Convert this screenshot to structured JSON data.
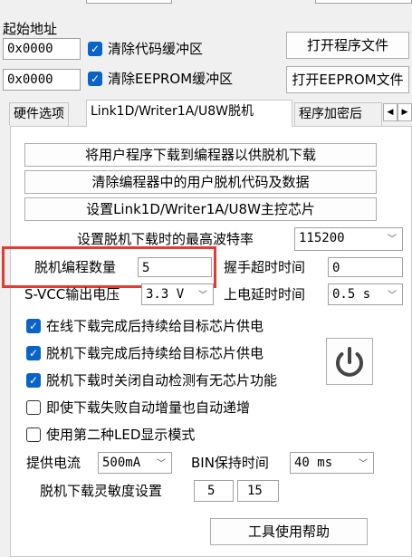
{
  "top": {
    "start_address_label": "起始地址",
    "code_addr_value": "0x0000",
    "clear_code_label": "清除代码缓冲区",
    "open_program_button": "打开程序文件",
    "eeprom_addr_value": "0x0000",
    "clear_eeprom_label": "清除EEPROM缓冲区",
    "open_eeprom_button": "打开EEPROM文件"
  },
  "tabs": [
    {
      "label": "硬件选项"
    },
    {
      "label": "Link1D/Writer1A/U8W脱机"
    },
    {
      "label": "程序加密后"
    }
  ],
  "tab_scroll": {
    "left": "◀",
    "right": "▶"
  },
  "panel": {
    "download_user_program_button": "将用户程序下载到编程器以供脱机下载",
    "clear_offline_code_button": "清除编程器中的用户脱机代码及数据",
    "set_main_chip_button": "设置Link1D/Writer1A/U8W主控芯片",
    "max_baud_label": "设置脱机下载时的最高波特率",
    "max_baud_value": "115200",
    "offline_count_label": "脱机编程数量",
    "offline_count_value": "5",
    "handshake_timeout_label": "握手超时时间",
    "handshake_timeout_value": "0",
    "svcc_label": "S-VCC输出电压",
    "svcc_value": "3.3 V",
    "power_delay_label": "上电延时时间",
    "power_delay_value": "0.5 s",
    "options": [
      {
        "label": "在线下载完成后持续给目标芯片供电",
        "checked": true
      },
      {
        "label": "脱机下载完成后持续给目标芯片供电",
        "checked": true
      },
      {
        "label": "脱机下载时关闭自动检测有无芯片功能",
        "checked": true
      },
      {
        "label": "即使下载失败自动增量也自动递增",
        "checked": false
      },
      {
        "label": "使用第二种LED显示模式",
        "checked": false
      }
    ],
    "supply_current_label": "提供电流",
    "supply_current_value": "500mA",
    "bin_hold_label": "BIN保持时间",
    "bin_hold_value": "40 ms",
    "sensitivity_label": "脱机下载灵敏度设置",
    "sensitivity_value1": "5",
    "sensitivity_value2": "15",
    "help_button": "工具使用帮助"
  },
  "colors": {
    "highlight_box": "#e53935",
    "checkbox_accent": "#0a64c8"
  }
}
